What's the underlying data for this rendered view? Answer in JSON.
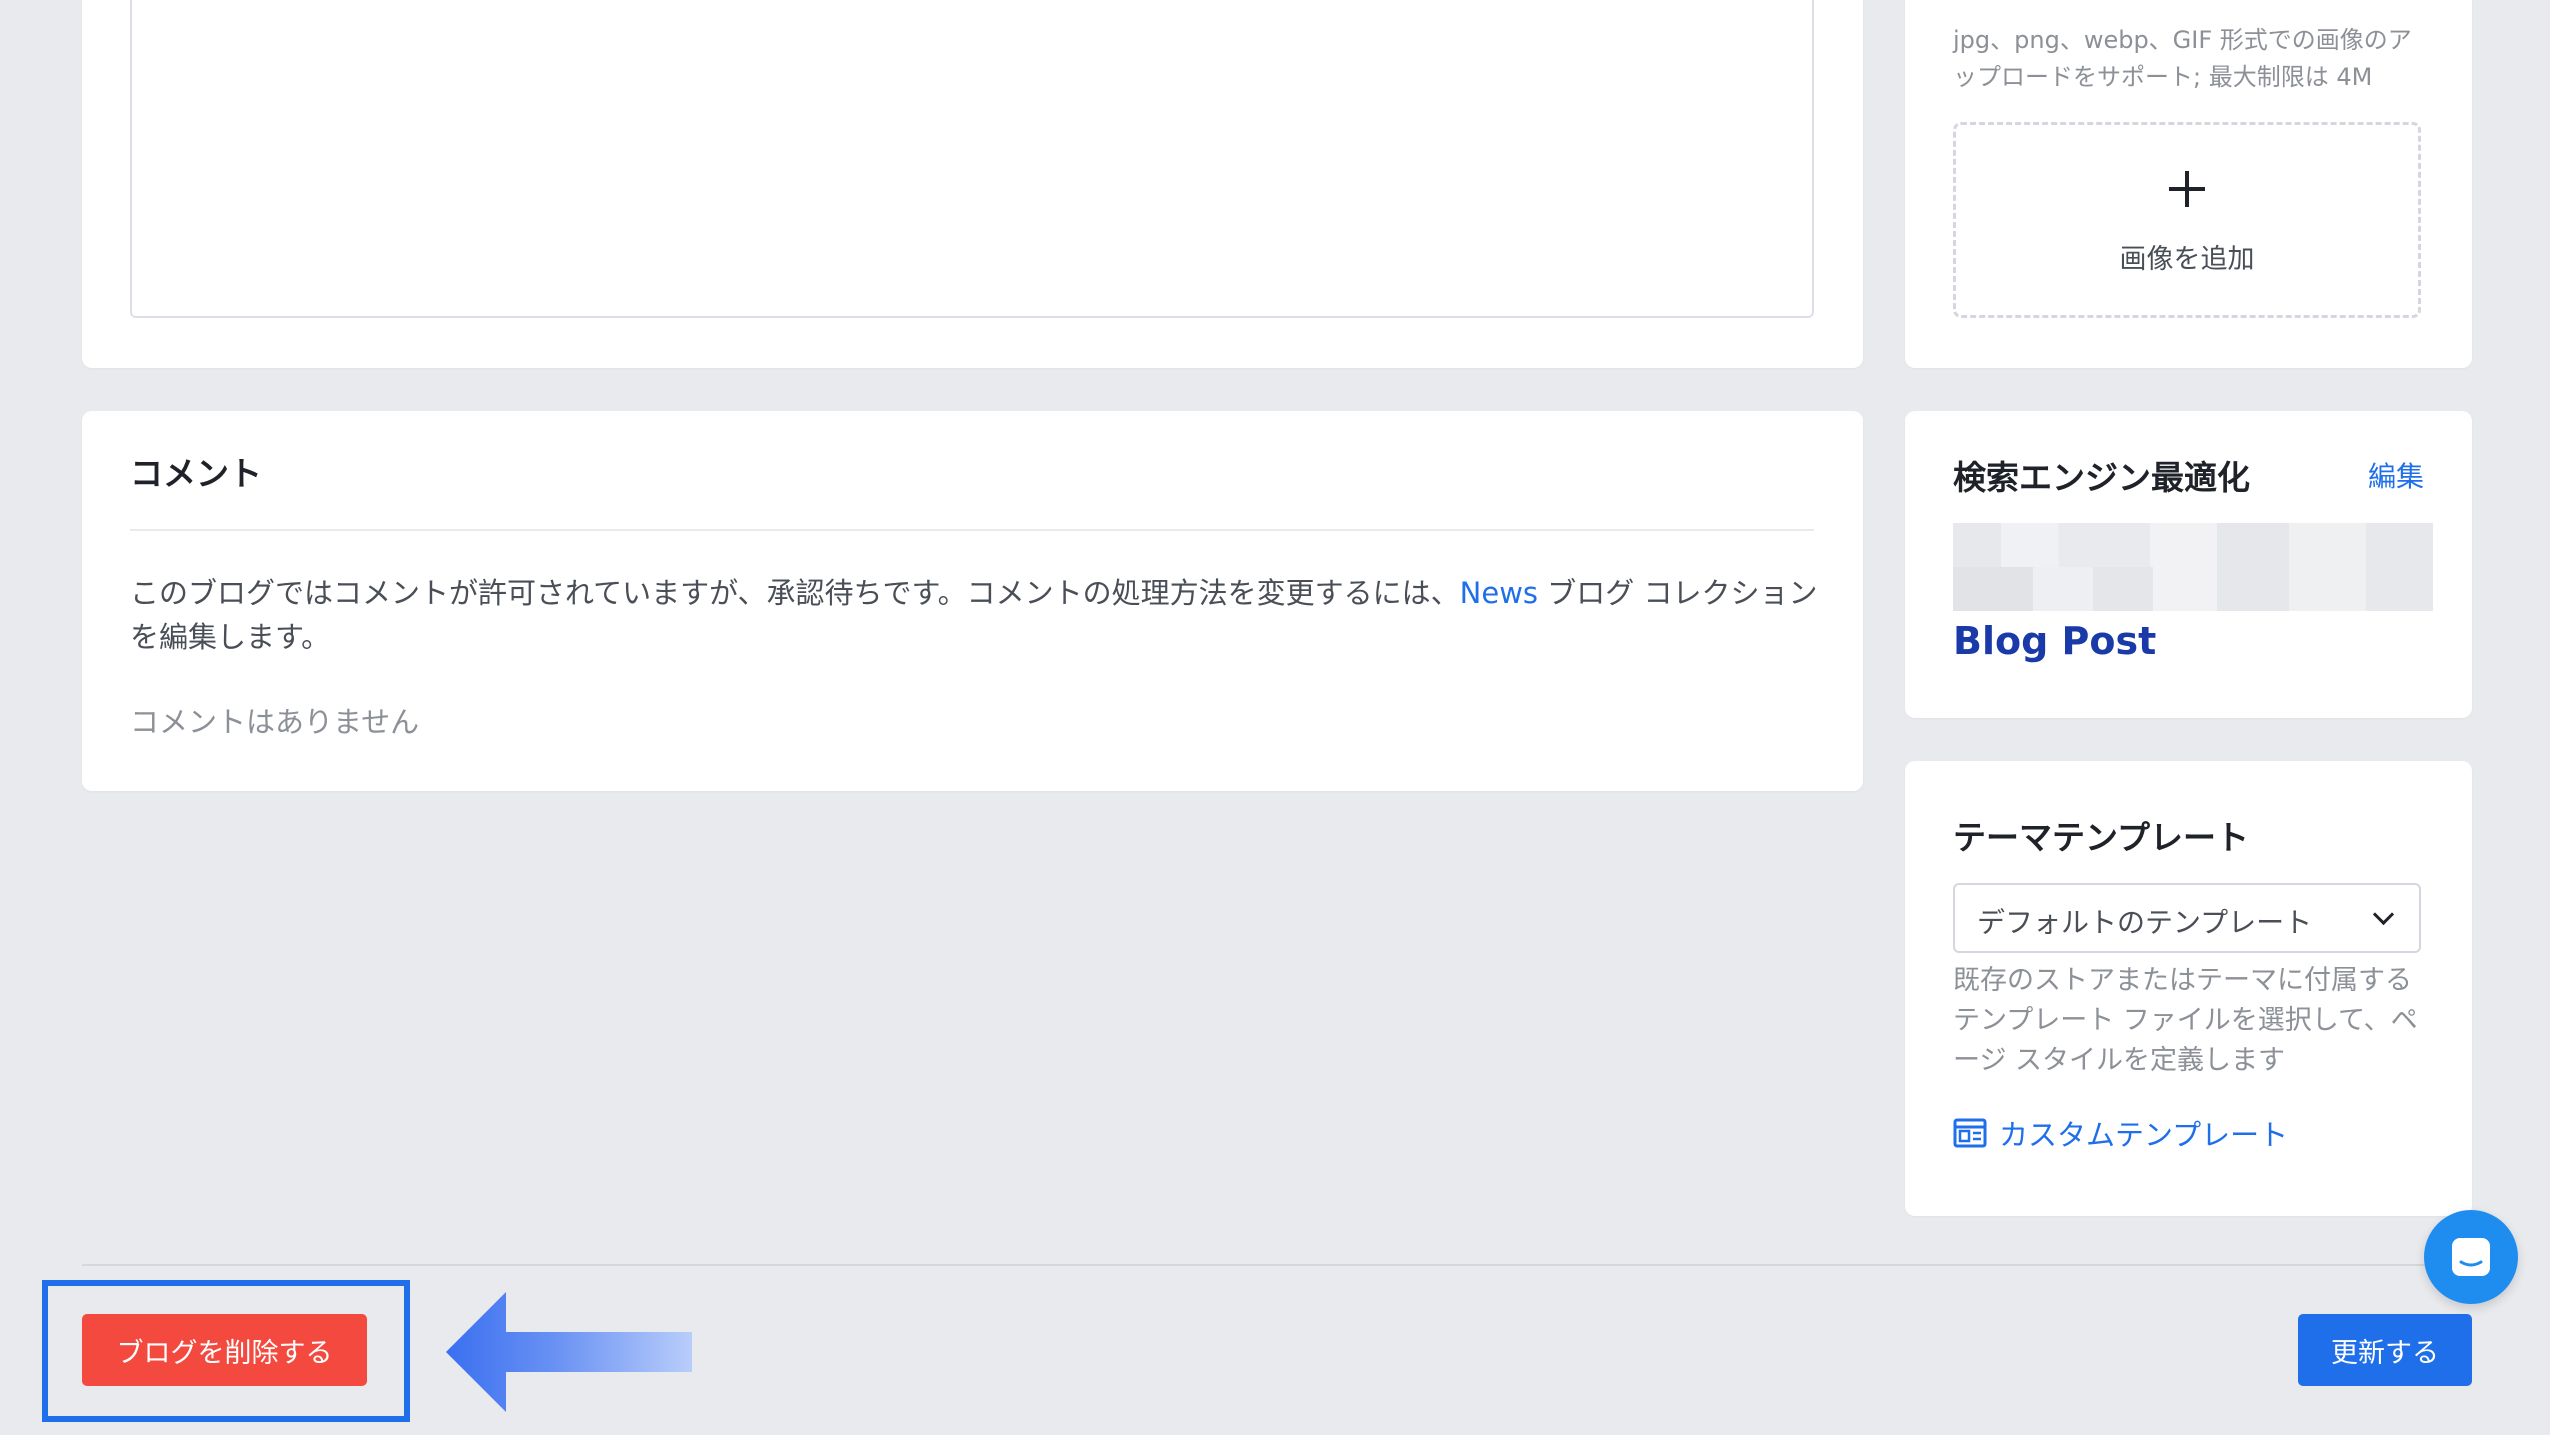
{
  "editor": {},
  "comments": {
    "title": "コメント",
    "description_before_link": "このブログではコメントが許可されていますが、承認待ちです。コメントの処理方法を変更するには、",
    "collection_link": "News",
    "description_after_link": " ブログ コレクションを編集します。",
    "empty_text": "コメントはありません"
  },
  "image_upload": {
    "hint": "jpg、png、webp、GIF 形式での画像のアップロードをサポート; 最大制限は 4M",
    "add_label": "画像を追加",
    "icon": "plus-icon"
  },
  "seo": {
    "title": "検索エンジン最適化",
    "edit_label": "編集",
    "preview_title": "Blog Post"
  },
  "theme_template": {
    "title": "テーマテンプレート",
    "selected": "デフォルトのテンプレート",
    "description": "既存のストアまたはテーマに付属するテンプレート ファイルを選択して、ページ スタイルを定義します",
    "custom_link": "カスタムテンプレート",
    "custom_icon": "template-icon"
  },
  "footer": {
    "delete_label": "ブログを削除する",
    "update_label": "更新する"
  },
  "colors": {
    "accent": "#1f6feb",
    "danger": "#f4493e",
    "background": "#e8eaee"
  }
}
